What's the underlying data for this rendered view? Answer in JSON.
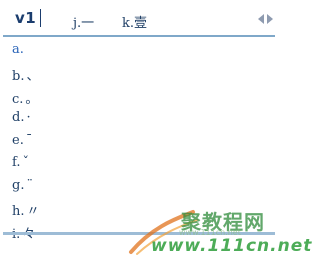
{
  "composition": {
    "text": "v1"
  },
  "top_candidates": [
    {
      "key": "j.",
      "text": "一"
    },
    {
      "key": "k.",
      "text": "壹"
    }
  ],
  "paging": {
    "prev_icon": "triangle-left-icon",
    "next_icon": "triangle-right-icon"
  },
  "candidates": [
    {
      "key": "a.",
      "symbol": ""
    },
    {
      "key": "b.",
      "symbol": "、"
    },
    {
      "key": "c.",
      "symbol": "。"
    },
    {
      "key": "d.",
      "symbol": "·"
    },
    {
      "key": "e.",
      "symbol": "ˉ"
    },
    {
      "key": "f.",
      "symbol": "ˇ"
    },
    {
      "key": "g.",
      "symbol": "¨"
    },
    {
      "key": "h.",
      "symbol": "〃"
    },
    {
      "key": "i.",
      "symbol": "々"
    }
  ],
  "watermark": {
    "brand": "聚教程网",
    "url_small": "www.111cn.net",
    "url": "www.111cn.net"
  },
  "colors": {
    "composition": "#1b3d6e",
    "text": "#1f3f66",
    "highlight_key": "#2a64b8",
    "divider": "#7fa8c9",
    "watermark_green": "#2e8b3a"
  }
}
